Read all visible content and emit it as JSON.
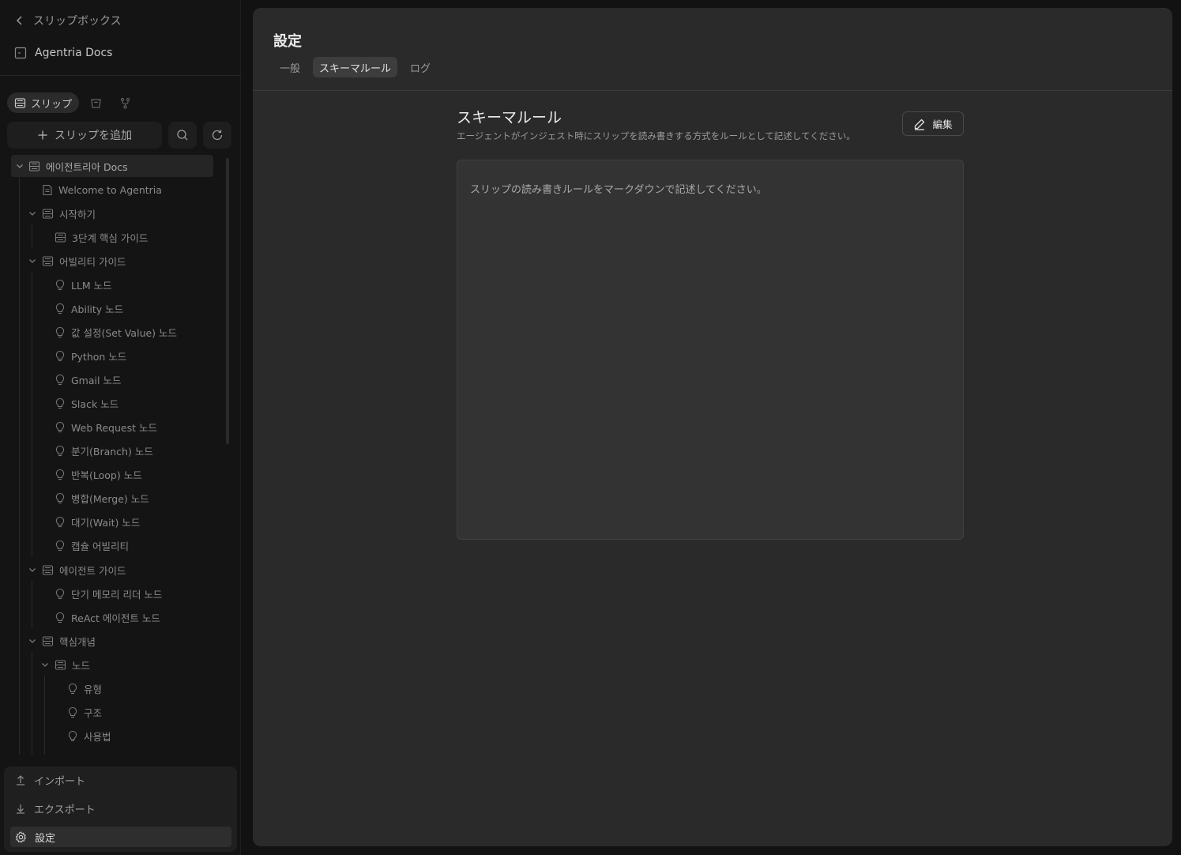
{
  "sidebar": {
    "back_label": "スリップボックス",
    "workspace_name": "Agentria Docs",
    "type_tabs": {
      "slip_label": "スリップ"
    },
    "add_slip_label": "スリップを追加",
    "tree": [
      {
        "label": "에이전트리아 Docs",
        "icon": "folder-icon"
      },
      {
        "label": "Welcome to Agentria",
        "icon": "document-icon"
      },
      {
        "label": "시작하기",
        "icon": "folder-icon"
      },
      {
        "label": "3단계 핵심 가이드",
        "icon": "folder-icon"
      },
      {
        "label": "어빌리티 가이드",
        "icon": "folder-icon"
      },
      {
        "label": "LLM 노드",
        "icon": "bulb-icon"
      },
      {
        "label": "Ability 노드",
        "icon": "bulb-icon"
      },
      {
        "label": "값 설정(Set Value) 노드",
        "icon": "bulb-icon"
      },
      {
        "label": "Python 노드",
        "icon": "bulb-icon"
      },
      {
        "label": "Gmail 노드",
        "icon": "bulb-icon"
      },
      {
        "label": "Slack 노드",
        "icon": "bulb-icon"
      },
      {
        "label": "Web Request 노드",
        "icon": "bulb-icon"
      },
      {
        "label": "분기(Branch) 노드",
        "icon": "bulb-icon"
      },
      {
        "label": "반복(Loop) 노드",
        "icon": "bulb-icon"
      },
      {
        "label": "병합(Merge) 노드",
        "icon": "bulb-icon"
      },
      {
        "label": "대기(Wait) 노드",
        "icon": "bulb-icon"
      },
      {
        "label": "캡슐 어빌리티",
        "icon": "bulb-icon"
      },
      {
        "label": "에이전트 가이드",
        "icon": "folder-icon"
      },
      {
        "label": "단기 메모리 리더 노드",
        "icon": "bulb-icon"
      },
      {
        "label": "ReAct 에이전트 노드",
        "icon": "bulb-icon"
      },
      {
        "label": "핵심개념",
        "icon": "folder-icon"
      },
      {
        "label": "노드",
        "icon": "folder-icon"
      },
      {
        "label": "유형",
        "icon": "bulb-icon"
      },
      {
        "label": "구조",
        "icon": "bulb-icon"
      },
      {
        "label": "사용법",
        "icon": "bulb-icon"
      }
    ],
    "bottom": {
      "import_label": "インポート",
      "export_label": "エクスポート",
      "settings_label": "設定"
    }
  },
  "main": {
    "title": "設定",
    "tabs": [
      "一般",
      "スキーマルール",
      "ログ"
    ],
    "active_tab": "スキーマルール",
    "section_title": "スキーマルール",
    "section_desc": "エージェントがインジェスト時にスリップを読み書きする方式をルールとして記述してください。",
    "edit_label": "編集",
    "rules_placeholder": "スリップの読み書きルールをマークダウンで記述してください。"
  },
  "colors": {
    "background": "#121212",
    "sidebar": "#141414",
    "main_panel": "#2a2a2a",
    "text_primary": "#ececec",
    "text_muted": "#8a8a8a"
  }
}
